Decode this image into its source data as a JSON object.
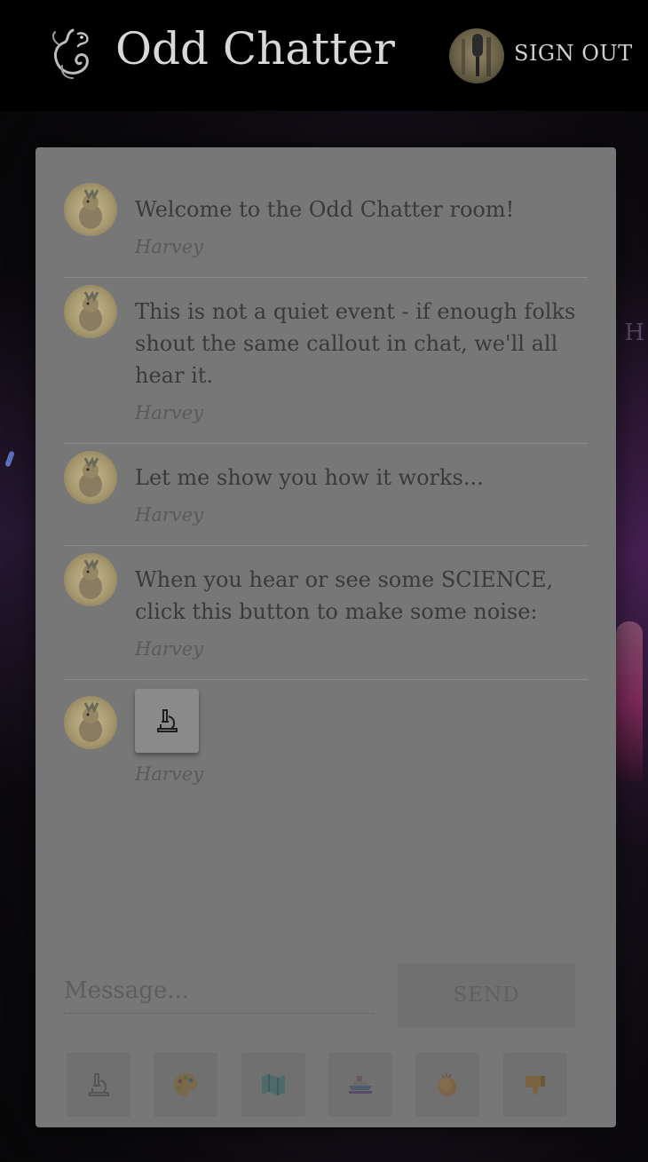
{
  "header": {
    "title": "Odd Chatter",
    "sign_out_label": "SIGN OUT",
    "logo_icon": "dragon-logo-icon",
    "user_avatar": "microphone-avatar"
  },
  "messages": [
    {
      "text": "Welcome to the Odd Chatter room!",
      "author": "Harvey"
    },
    {
      "text": "This is not a quiet event - if enough folks shout the same callout in chat, we'll all hear it.",
      "author": "Harvey"
    },
    {
      "text": "Let me show you how it works...",
      "author": "Harvey"
    },
    {
      "text": "When you hear or see some SCIENCE, click this button to make some noise:",
      "author": "Harvey"
    },
    {
      "text": "",
      "author": "Harvey",
      "attachment": "microscope-icon"
    }
  ],
  "composer": {
    "placeholder": "Message...",
    "send_label": "SEND"
  },
  "reactions": [
    {
      "icon": "microscope-icon"
    },
    {
      "icon": "palette-icon"
    },
    {
      "icon": "map-icon"
    },
    {
      "icon": "ship-icon"
    },
    {
      "icon": "clapping-hands-icon"
    },
    {
      "icon": "thumbs-down-icon"
    }
  ],
  "colors": {
    "panel_bg": "#777777",
    "page_bg": "#000000",
    "text_dark": "#3a3a3a",
    "header_text": "#d8d8d8"
  }
}
